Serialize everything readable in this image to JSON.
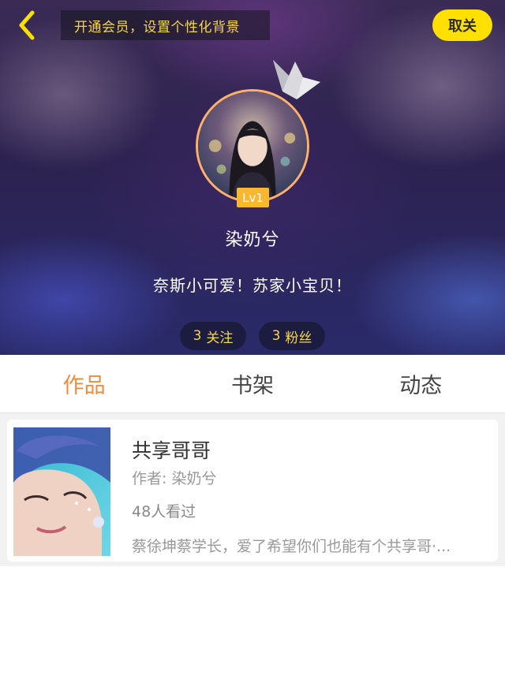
{
  "header": {
    "vip_banner": "开通会员，设置个性化背景",
    "follow_label": "取关",
    "back_icon": "chevron-left-icon",
    "crown_icon": "crown-icon"
  },
  "profile": {
    "level": "Lv1",
    "username": "染奶兮",
    "bio": "奈斯小可爱！苏家小宝贝！",
    "following_count": "3",
    "following_label": "关注",
    "fans_count": "3",
    "fans_label": "粉丝"
  },
  "tabs": [
    {
      "label": "作品",
      "active": true
    },
    {
      "label": "书架",
      "active": false
    },
    {
      "label": "动态",
      "active": false
    }
  ],
  "works": [
    {
      "title": "共享哥哥",
      "author": "作者: 染奶兮",
      "views": "48人看过",
      "summary": "蔡徐坤蔡学长，爱了希望你们也能有个共享哥·..."
    }
  ],
  "colors": {
    "accent_orange": "#ef8b3d",
    "follow_yellow": "#ffe000",
    "banner_text": "#f6d64a",
    "level_badge": "#f7b731"
  }
}
